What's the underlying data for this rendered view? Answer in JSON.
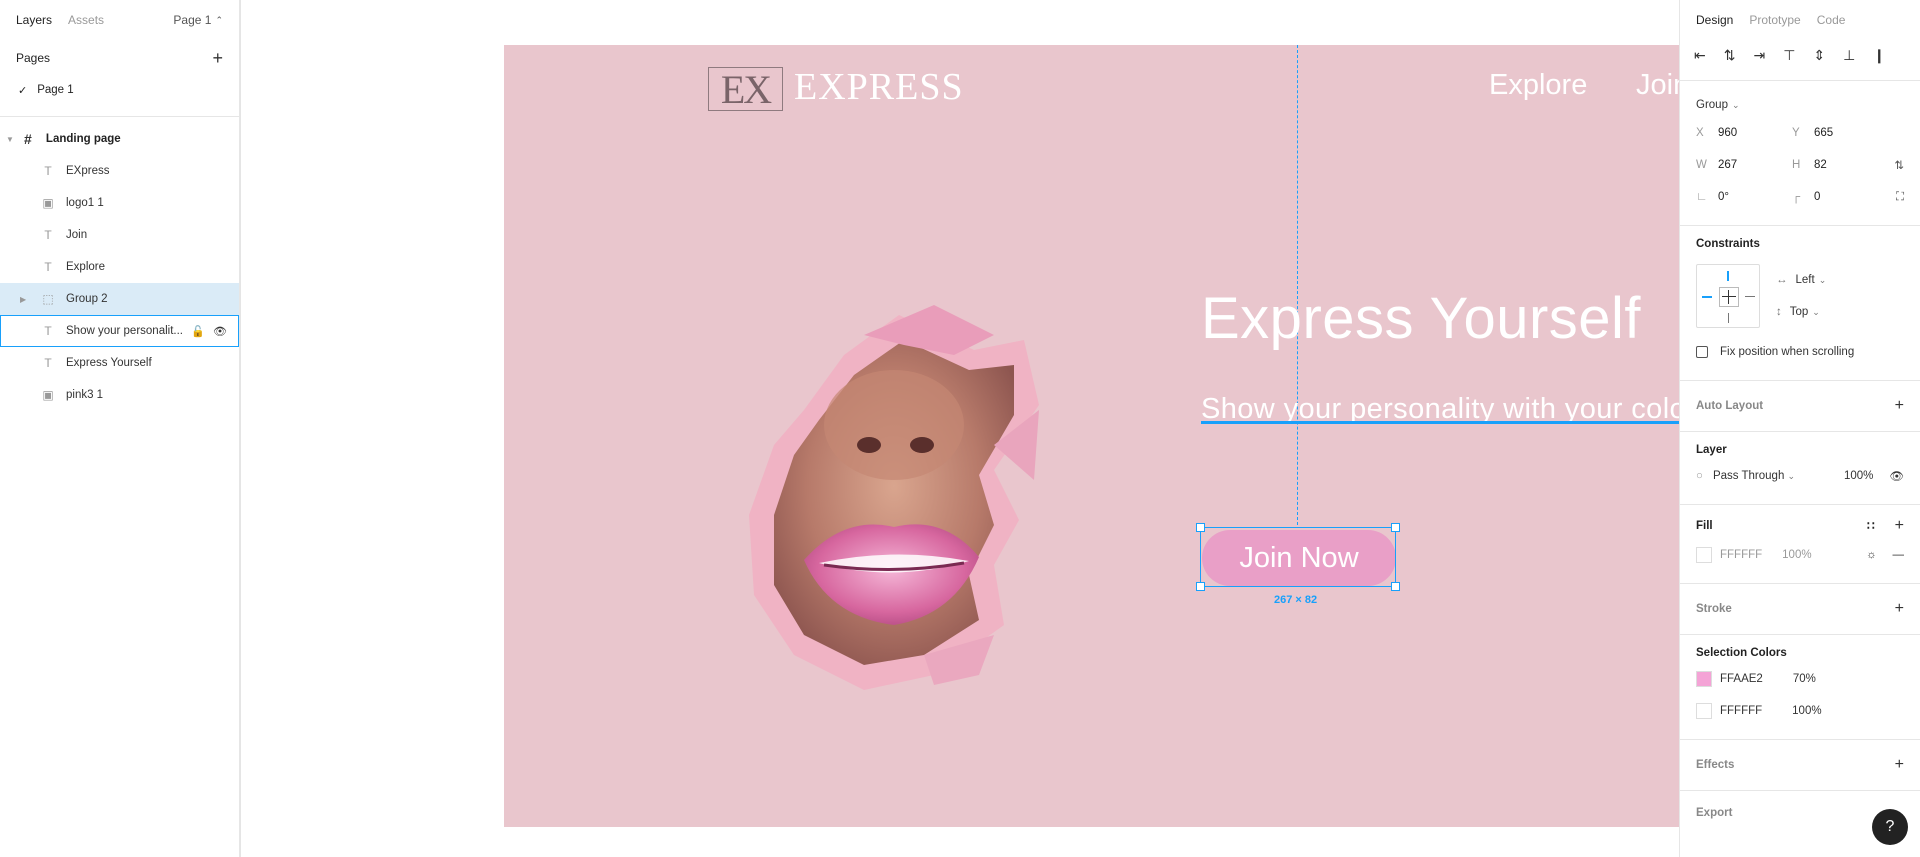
{
  "left_panel": {
    "tabs": [
      "Layers",
      "Assets"
    ],
    "page_selector": "Page 1",
    "pages_header": "Pages",
    "pages": [
      "Page 1"
    ],
    "frame_name": "Landing page",
    "layers": [
      "EXpress",
      "logo1 1",
      "Join",
      "Explore",
      "Group 2",
      "Show your personalit...",
      "Express Yourself",
      "pink3 1"
    ]
  },
  "canvas": {
    "brand_logo": "EX",
    "brand_name": "EXPRESS",
    "nav": {
      "explore": "Explore",
      "join": "Join"
    },
    "hero_title": "Express Yourself",
    "hero_subtitle": "Show your personality with your colors",
    "cta_button": "Join Now",
    "selection_dims": "267 × 82"
  },
  "right_panel": {
    "tabs": [
      "Design",
      "Prototype",
      "Code"
    ],
    "group_label": "Group",
    "x_label": "X",
    "x": "960",
    "y_label": "Y",
    "y": "665",
    "w_label": "W",
    "w": "267",
    "h_label": "H",
    "h": "82",
    "rotation": "0°",
    "radius": "0",
    "constraints_title": "Constraints",
    "constraint_h": "Left",
    "constraint_v": "Top",
    "fix_position": "Fix position when scrolling",
    "auto_layout": "Auto Layout",
    "layer_title": "Layer",
    "blend_mode": "Pass Through",
    "layer_opacity": "100%",
    "fill_title": "Fill",
    "fill_hex": "FFFFFF",
    "fill_opacity": "100%",
    "stroke_title": "Stroke",
    "selection_colors_title": "Selection Colors",
    "selection_colors": [
      {
        "hex": "FFAAE2",
        "opacity": "70%",
        "color": "#f4a3d6"
      },
      {
        "hex": "FFFFFF",
        "opacity": "100%",
        "color": "#ffffff"
      }
    ],
    "effects_title": "Effects",
    "export_title": "Export"
  },
  "help_label": "?"
}
